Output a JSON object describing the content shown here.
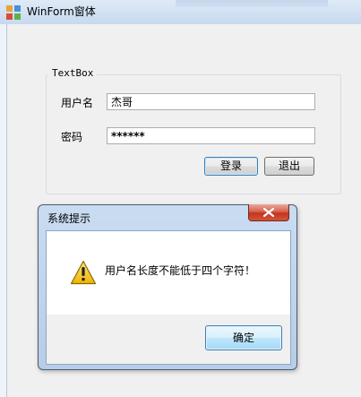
{
  "window": {
    "title": "WinForm窗体",
    "icon": "winform-app-icon"
  },
  "groupbox": {
    "label": "TextBox",
    "username_label": "用户名",
    "username_value": "杰哥",
    "password_label": "密码",
    "password_value": "******",
    "login_button": "登录",
    "exit_button": "退出"
  },
  "messagebox": {
    "title": "系统提示",
    "message": "用户名长度不能低于四个字符！",
    "ok_button": "确定",
    "icon": "warning-icon",
    "close_icon": "close-icon"
  },
  "colors": {
    "titlebar": "#c7d9ef",
    "close_button": "#c4341d",
    "focus_border": "#3c7fb1"
  }
}
